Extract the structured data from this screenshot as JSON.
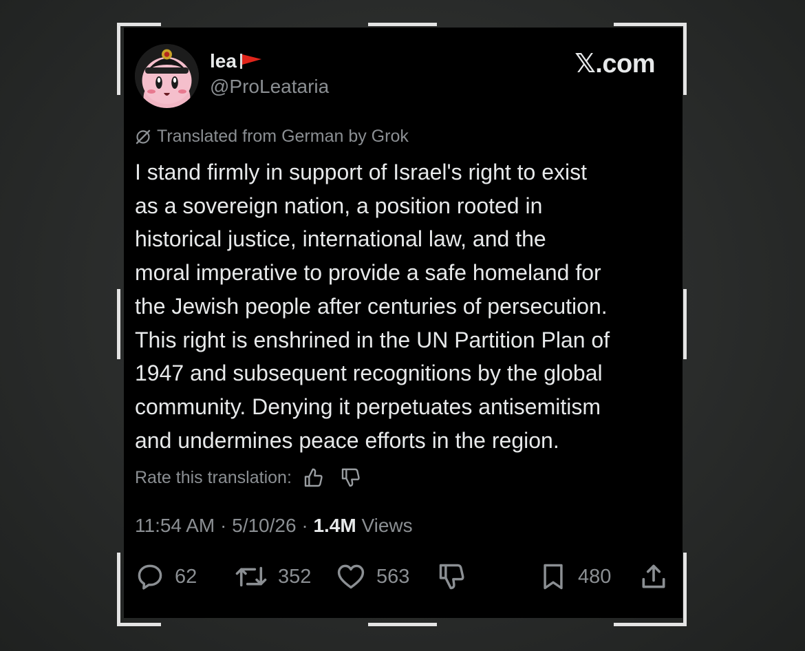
{
  "header": {
    "display_name": "lea",
    "handle": "@ProLeataria",
    "brand": "𝕏.com"
  },
  "translation_note": "Translated from German by Grok",
  "tweet": {
    "lines": [
      "I stand firmly in support of Israel's right to exist",
      "as a sovereign nation, a position rooted in",
      "historical justice, international law, and the",
      "moral imperative to provide a safe homeland for",
      "the Jewish people after centuries of persecution.",
      "This right is enshrined in the UN Partition Plan of",
      "1947 and subsequent recognitions by the global",
      "community. Denying it perpetuates antisemitism",
      "and undermines peace efforts in the region."
    ]
  },
  "rate_label": "Rate this translation:",
  "meta": {
    "time": "11:54 AM",
    "separator": "·",
    "date": "5/10/26",
    "views_count": "1.4M",
    "views_label": "Views"
  },
  "actions": {
    "replies": "62",
    "reposts": "352",
    "likes": "563",
    "bookmarks": "480"
  },
  "icons": {
    "name_flag": "red-flag-icon",
    "translate": "grok-translate-icon",
    "rate_up": "thumbs-up-icon",
    "rate_down": "thumbs-down-icon",
    "reply": "reply-icon",
    "repost": "repost-icon",
    "like": "heart-icon",
    "dislike": "thumbs-down-icon",
    "bookmark": "bookmark-icon",
    "share": "share-icon"
  },
  "colors": {
    "card_bg": "#000000",
    "primary_text": "#e7e9ea",
    "secondary_text": "#8b8f93",
    "flag_red": "#e0251b"
  }
}
